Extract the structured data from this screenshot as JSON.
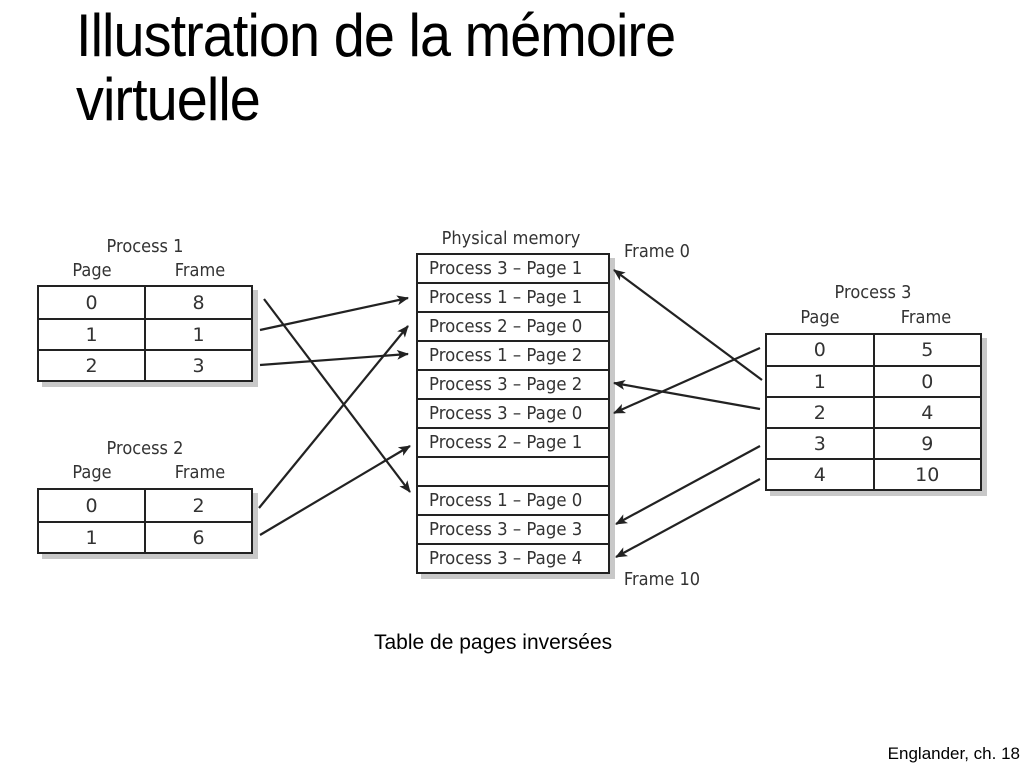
{
  "title": {
    "line1": "Illustration de la mémoire",
    "line2": "virtuelle"
  },
  "diagram": {
    "column_headers": {
      "page": "Page",
      "frame": "Frame"
    },
    "process_tables": [
      {
        "name": "Process 1",
        "rows": [
          {
            "page": "0",
            "frame": "8"
          },
          {
            "page": "1",
            "frame": "1"
          },
          {
            "page": "2",
            "frame": "3"
          }
        ]
      },
      {
        "name": "Process 2",
        "rows": [
          {
            "page": "0",
            "frame": "2"
          },
          {
            "page": "1",
            "frame": "6"
          }
        ]
      },
      {
        "name": "Process 3",
        "rows": [
          {
            "page": "0",
            "frame": "5"
          },
          {
            "page": "1",
            "frame": "0"
          },
          {
            "page": "2",
            "frame": "4"
          },
          {
            "page": "3",
            "frame": "9"
          },
          {
            "page": "4",
            "frame": "10"
          }
        ]
      }
    ],
    "physical_memory": {
      "title": "Physical memory",
      "frames": [
        "Process 3 – Page 1",
        "Process 1 – Page 1",
        "Process 2 – Page 0",
        "Process 1 – Page 2",
        "Process 3 – Page 2",
        "Process 3 – Page 0",
        "Process 2 – Page 1",
        "",
        "Process 1 – Page 0",
        "Process 3 – Page 3",
        "Process 3 – Page 4"
      ],
      "first_frame_label": "Frame 0",
      "last_frame_label": "Frame 10"
    }
  },
  "caption": "Table de pages inversées",
  "citation": "Englander, ch. 18"
}
